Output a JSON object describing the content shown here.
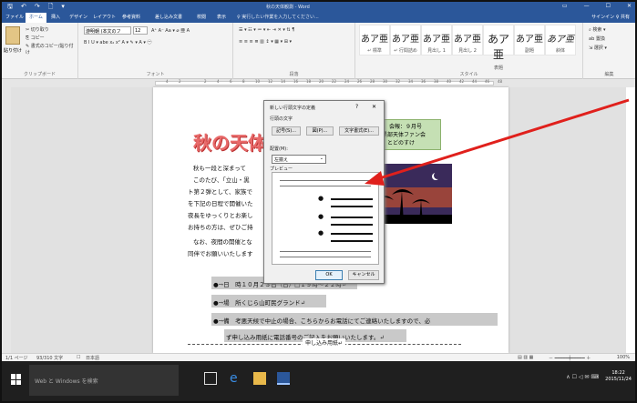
{
  "window": {
    "title": "秋の天体観測 - Word"
  },
  "quick_access": {
    "save": "🖫",
    "undo": "↶",
    "redo": "↷",
    "new": "🗋",
    "more": "▾"
  },
  "tabs": [
    "ファイル",
    "ホーム",
    "挿入",
    "デザイン",
    "レイアウト",
    "参考資料",
    "差し込み文書",
    "校閲",
    "表示"
  ],
  "tell_me": "♀ 実行したい作業を入力してください...",
  "account": "サインイン  ♀ 共有",
  "clipboard": {
    "paste": "貼り付け",
    "cut": "✂ 切り取り",
    "copy": "⎘ コピー",
    "format_painter": "✎ 書式のコピー/貼り付け",
    "label": "クリップボード"
  },
  "font": {
    "name": "游明朝 (本文のフ",
    "size": "12",
    "row1": "A⁺ A⁻  Aa ▾  ⌀  亜  A",
    "row2": "B  I  U ▾ abe  x₂  x²  A ▾  ✎ ▾  A ▾  ㊀",
    "label": "フォント"
  },
  "paragraph": {
    "row1": "☰ ▾  ☷ ▾  ≔ ▾  ⇤  ⇥  ✕ ▾  ⇅  ¶",
    "row2": "≡  ≡  ≡  ≣  ▥  ↕ ▾  ▦ ▾  ⊞ ▾",
    "label": "段落"
  },
  "styles": {
    "items": [
      {
        "s": "あア亜",
        "n": "↵ 標準"
      },
      {
        "s": "あア亜",
        "n": "↵ 行間詰め"
      },
      {
        "s": "あア亜",
        "n": "見出し 1"
      },
      {
        "s": "あア亜",
        "n": "見出し 2"
      },
      {
        "s": "あア亜",
        "n": "表題"
      },
      {
        "s": "あア亜",
        "n": "副題"
      },
      {
        "s": "あア亜",
        "n": "斜体"
      }
    ],
    "label": "スタイル"
  },
  "editing": {
    "find": "⌕ 検索 ▾",
    "replace": "ab 置換",
    "select": "⇲ 選択 ▾",
    "label": "編集"
  },
  "ruler": {
    "numbers": [
      "4",
      "2",
      "2",
      "4",
      "6",
      "8",
      "10",
      "12",
      "14",
      "16",
      "18",
      "20",
      "22",
      "24",
      "26",
      "28",
      "30",
      "32",
      "34",
      "36",
      "38",
      "40",
      "42",
      "44",
      "46",
      "48"
    ]
  },
  "document": {
    "title": "秋の天体",
    "info_box": [
      "会報：９月号",
      "山・黒部天体ファン会",
      "吾郎、とどのすけ"
    ],
    "lines": [
      "秋も一段と深まって",
      "このたび、「立山・黒",
      "ト第２弾として、家族で",
      "を下記の日程で開催いた",
      "夜長をゆっくりとお楽し",
      "お持ちの方は、ぜひご持",
      "なお、夜間の開催とな",
      "同伴でお願いいたします"
    ],
    "bullets": [
      "●→日　時１０月２３日（日）□１９時～２２時↵",
      "●→場　所くじら山町民グランド↵",
      "●→備　考悪天候で中止の場合、こちらからお電話にてご連絡いたしますので、必",
      "ず申し込み用紙に電話番号のご記入をお願いいたします。↵"
    ],
    "mail_label": "申し込み用紙↵"
  },
  "dialog": {
    "title": "新しい行頭文字の定義",
    "help": "?",
    "close": "✕",
    "section_char": "行頭の文字",
    "symbol_btn": "記号(S)...",
    "picture_btn": "図(P)...",
    "font_btn": "文字書式(E)...",
    "align_label": "配置(M):",
    "align_value": "左揃え",
    "preview_label": "プレビュー",
    "ok": "OK",
    "cancel": "キャンセル"
  },
  "status": {
    "page": "1/1 ページ",
    "words": "93/310 文字",
    "proof": "☐",
    "lang": "日本語",
    "zoom": "100%"
  },
  "taskbar": {
    "search": "Web と Windows を検索",
    "time": "18:22",
    "date": "2015/11/24"
  },
  "colors": {
    "accent": "#2b579a",
    "title_red": "#e86a6a",
    "info_green": "#c5e0b4",
    "arrow": "#e0201c",
    "highlight": "#c9c9c9"
  }
}
